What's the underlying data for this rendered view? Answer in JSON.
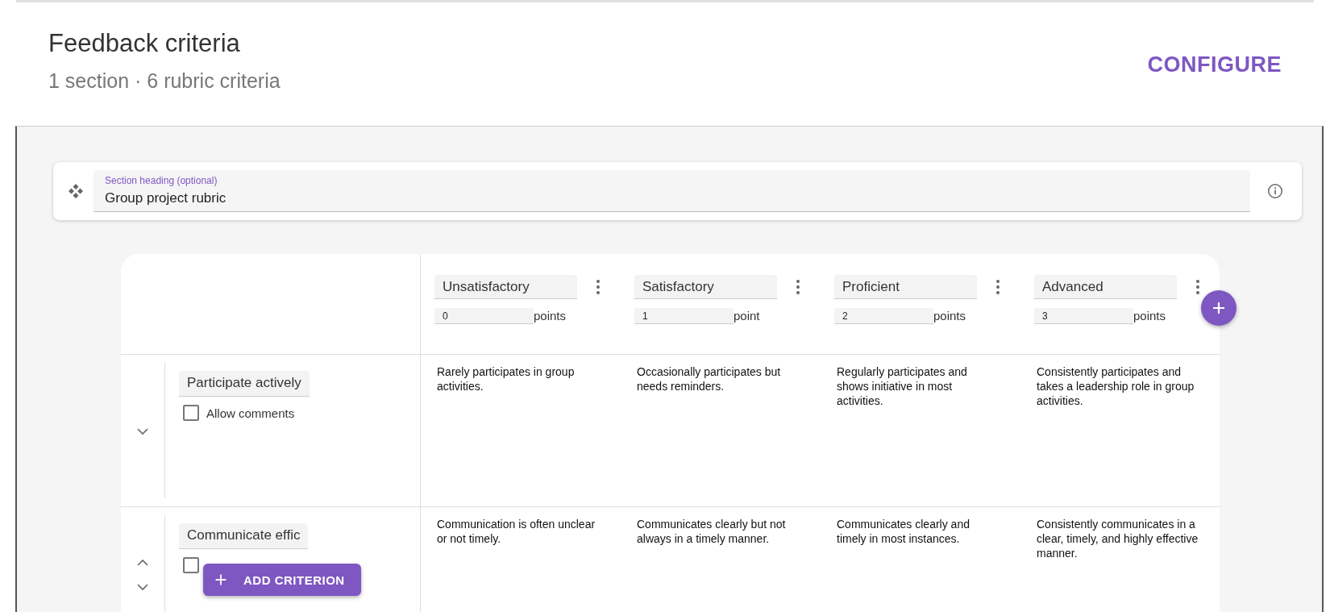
{
  "header": {
    "title": "Feedback criteria",
    "subtitle": "1 section · 6 rubric criteria",
    "configure_button": "CONFIGURE"
  },
  "section": {
    "label": "Section heading (optional)",
    "value": "Group project rubric"
  },
  "levels": [
    {
      "name": "Unsatisfactory",
      "points": "0",
      "unit": "points"
    },
    {
      "name": "Satisfactory",
      "points": "1",
      "unit": "point"
    },
    {
      "name": "Proficient",
      "points": "2",
      "unit": "points"
    },
    {
      "name": "Advanced",
      "points": "3",
      "unit": "points"
    }
  ],
  "criteria": [
    {
      "name": "Participate actively",
      "allow_comments": {
        "label": "Allow comments",
        "checked": false
      },
      "can_move_up": false,
      "can_move_down": true,
      "descriptions": [
        "Rarely participates in group activities.",
        "Occasionally participates but needs reminders.",
        "Regularly participates and shows initiative in most activities.",
        "Consistently participates and takes a leadership role in group activities."
      ]
    },
    {
      "name": "Communicate effic",
      "allow_comments": {
        "checked": false
      },
      "can_move_up": true,
      "can_move_down": true,
      "descriptions": [
        "Communication is often unclear or not timely.",
        "Communicates clearly but not always in a timely manner.",
        "Communicates clearly and timely in most instances.",
        "Consistently communicates in a clear, timely, and highly effective manner."
      ]
    }
  ],
  "add_criterion_button": "ADD CRITERION"
}
